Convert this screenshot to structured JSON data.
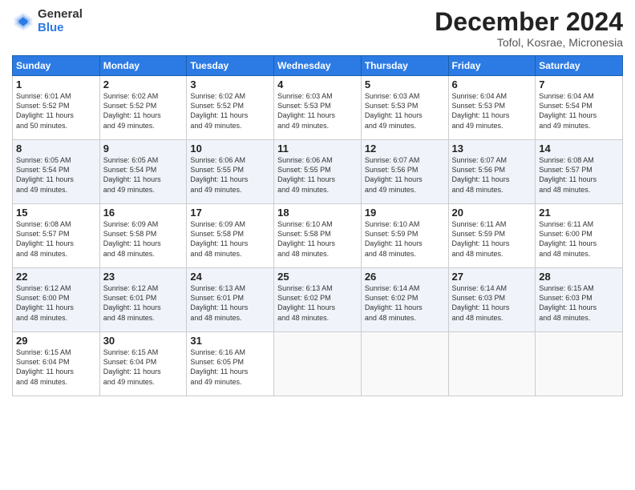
{
  "header": {
    "logo_general": "General",
    "logo_blue": "Blue",
    "main_title": "December 2024",
    "sub_title": "Tofol, Kosrae, Micronesia"
  },
  "days_of_week": [
    "Sunday",
    "Monday",
    "Tuesday",
    "Wednesday",
    "Thursday",
    "Friday",
    "Saturday"
  ],
  "weeks": [
    [
      {
        "day": "1",
        "info": "Sunrise: 6:01 AM\nSunset: 5:52 PM\nDaylight: 11 hours\nand 50 minutes."
      },
      {
        "day": "2",
        "info": "Sunrise: 6:02 AM\nSunset: 5:52 PM\nDaylight: 11 hours\nand 49 minutes."
      },
      {
        "day": "3",
        "info": "Sunrise: 6:02 AM\nSunset: 5:52 PM\nDaylight: 11 hours\nand 49 minutes."
      },
      {
        "day": "4",
        "info": "Sunrise: 6:03 AM\nSunset: 5:53 PM\nDaylight: 11 hours\nand 49 minutes."
      },
      {
        "day": "5",
        "info": "Sunrise: 6:03 AM\nSunset: 5:53 PM\nDaylight: 11 hours\nand 49 minutes."
      },
      {
        "day": "6",
        "info": "Sunrise: 6:04 AM\nSunset: 5:53 PM\nDaylight: 11 hours\nand 49 minutes."
      },
      {
        "day": "7",
        "info": "Sunrise: 6:04 AM\nSunset: 5:54 PM\nDaylight: 11 hours\nand 49 minutes."
      }
    ],
    [
      {
        "day": "8",
        "info": "Sunrise: 6:05 AM\nSunset: 5:54 PM\nDaylight: 11 hours\nand 49 minutes."
      },
      {
        "day": "9",
        "info": "Sunrise: 6:05 AM\nSunset: 5:54 PM\nDaylight: 11 hours\nand 49 minutes."
      },
      {
        "day": "10",
        "info": "Sunrise: 6:06 AM\nSunset: 5:55 PM\nDaylight: 11 hours\nand 49 minutes."
      },
      {
        "day": "11",
        "info": "Sunrise: 6:06 AM\nSunset: 5:55 PM\nDaylight: 11 hours\nand 49 minutes."
      },
      {
        "day": "12",
        "info": "Sunrise: 6:07 AM\nSunset: 5:56 PM\nDaylight: 11 hours\nand 49 minutes."
      },
      {
        "day": "13",
        "info": "Sunrise: 6:07 AM\nSunset: 5:56 PM\nDaylight: 11 hours\nand 48 minutes."
      },
      {
        "day": "14",
        "info": "Sunrise: 6:08 AM\nSunset: 5:57 PM\nDaylight: 11 hours\nand 48 minutes."
      }
    ],
    [
      {
        "day": "15",
        "info": "Sunrise: 6:08 AM\nSunset: 5:57 PM\nDaylight: 11 hours\nand 48 minutes."
      },
      {
        "day": "16",
        "info": "Sunrise: 6:09 AM\nSunset: 5:58 PM\nDaylight: 11 hours\nand 48 minutes."
      },
      {
        "day": "17",
        "info": "Sunrise: 6:09 AM\nSunset: 5:58 PM\nDaylight: 11 hours\nand 48 minutes."
      },
      {
        "day": "18",
        "info": "Sunrise: 6:10 AM\nSunset: 5:58 PM\nDaylight: 11 hours\nand 48 minutes."
      },
      {
        "day": "19",
        "info": "Sunrise: 6:10 AM\nSunset: 5:59 PM\nDaylight: 11 hours\nand 48 minutes."
      },
      {
        "day": "20",
        "info": "Sunrise: 6:11 AM\nSunset: 5:59 PM\nDaylight: 11 hours\nand 48 minutes."
      },
      {
        "day": "21",
        "info": "Sunrise: 6:11 AM\nSunset: 6:00 PM\nDaylight: 11 hours\nand 48 minutes."
      }
    ],
    [
      {
        "day": "22",
        "info": "Sunrise: 6:12 AM\nSunset: 6:00 PM\nDaylight: 11 hours\nand 48 minutes."
      },
      {
        "day": "23",
        "info": "Sunrise: 6:12 AM\nSunset: 6:01 PM\nDaylight: 11 hours\nand 48 minutes."
      },
      {
        "day": "24",
        "info": "Sunrise: 6:13 AM\nSunset: 6:01 PM\nDaylight: 11 hours\nand 48 minutes."
      },
      {
        "day": "25",
        "info": "Sunrise: 6:13 AM\nSunset: 6:02 PM\nDaylight: 11 hours\nand 48 minutes."
      },
      {
        "day": "26",
        "info": "Sunrise: 6:14 AM\nSunset: 6:02 PM\nDaylight: 11 hours\nand 48 minutes."
      },
      {
        "day": "27",
        "info": "Sunrise: 6:14 AM\nSunset: 6:03 PM\nDaylight: 11 hours\nand 48 minutes."
      },
      {
        "day": "28",
        "info": "Sunrise: 6:15 AM\nSunset: 6:03 PM\nDaylight: 11 hours\nand 48 minutes."
      }
    ],
    [
      {
        "day": "29",
        "info": "Sunrise: 6:15 AM\nSunset: 6:04 PM\nDaylight: 11 hours\nand 48 minutes."
      },
      {
        "day": "30",
        "info": "Sunrise: 6:15 AM\nSunset: 6:04 PM\nDaylight: 11 hours\nand 49 minutes."
      },
      {
        "day": "31",
        "info": "Sunrise: 6:16 AM\nSunset: 6:05 PM\nDaylight: 11 hours\nand 49 minutes."
      },
      null,
      null,
      null,
      null
    ]
  ]
}
